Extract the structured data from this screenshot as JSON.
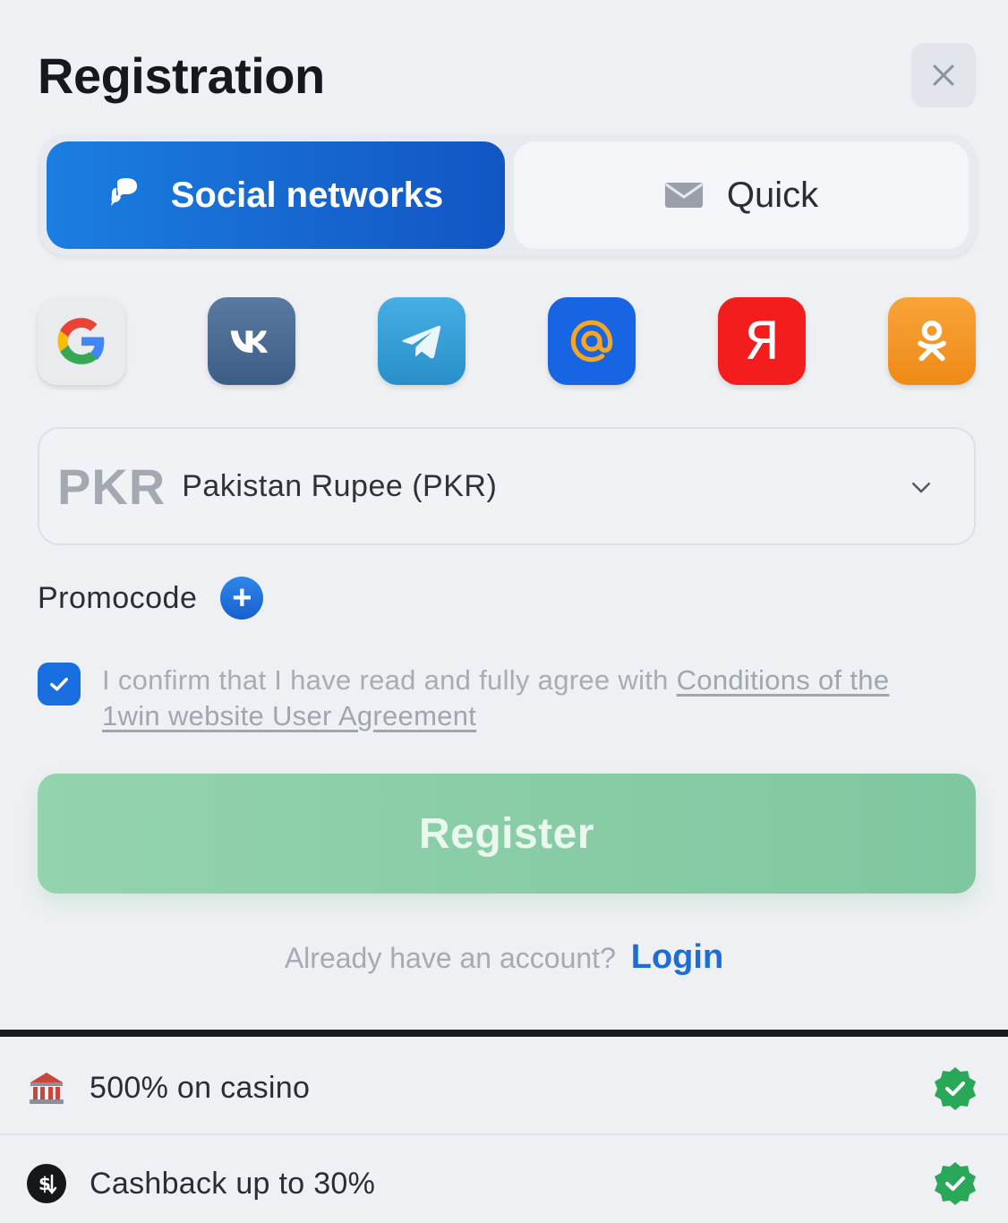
{
  "header": {
    "title": "Registration"
  },
  "tabs": [
    {
      "label": "Social networks",
      "active": true,
      "icon": "chat-bubbles-icon"
    },
    {
      "label": "Quick",
      "active": false,
      "icon": "envelope-icon"
    }
  ],
  "socials": [
    {
      "name": "google",
      "icon": "google-icon"
    },
    {
      "name": "vk",
      "icon": "vk-icon"
    },
    {
      "name": "telegram",
      "icon": "telegram-icon"
    },
    {
      "name": "mail",
      "icon": "at-sign-icon"
    },
    {
      "name": "yandex",
      "icon": "yandex-icon",
      "glyph": "Я"
    },
    {
      "name": "odnoklassniki",
      "icon": "ok-icon"
    }
  ],
  "currency": {
    "code": "PKR",
    "name": "Pakistan Rupee (PKR)"
  },
  "promo": {
    "label": "Promocode",
    "plus": "+"
  },
  "agreement": {
    "checked": true,
    "text": "I confirm that I have read and fully agree with ",
    "link": "Conditions of the 1win website User Agreement"
  },
  "register": {
    "label": "Register"
  },
  "login": {
    "prompt": "Already have an account?",
    "link": "Login"
  },
  "bonuses": [
    {
      "text": "500% on casino",
      "icon": "casino-icon"
    },
    {
      "text": "Cashback up to 30%",
      "icon": "cashback-icon"
    }
  ],
  "colors": {
    "primary": "#1a6fe0",
    "register_green": "#8ccfa8",
    "check_green": "#2aa85a",
    "background": "#eef0f3"
  }
}
